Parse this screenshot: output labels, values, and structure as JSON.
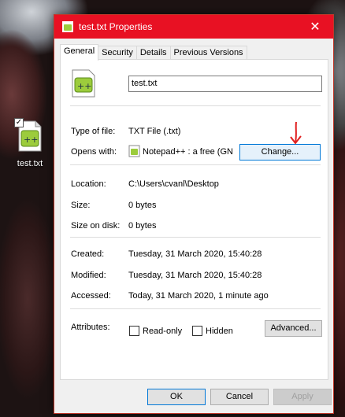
{
  "desktop": {
    "icon_label": "test.txt"
  },
  "window": {
    "title": "test.txt Properties",
    "close_glyph": "✕"
  },
  "tabs": [
    "General",
    "Security",
    "Details",
    "Previous Versions"
  ],
  "file": {
    "name": "test.txt",
    "type_label": "Type of file:",
    "type_value": "TXT File (.txt)",
    "opens_label": "Opens with:",
    "opens_value": "Notepad++ : a free (GN",
    "change_button": "Change...",
    "location_label": "Location:",
    "location_value": "C:\\Users\\cvanl\\Desktop",
    "size_label": "Size:",
    "size_value": "0 bytes",
    "size_on_disk_label": "Size on disk:",
    "size_on_disk_value": "0 bytes",
    "created_label": "Created:",
    "created_value": "Tuesday, 31 March 2020, 15:40:28",
    "modified_label": "Modified:",
    "modified_value": "Tuesday, 31 March 2020, 15:40:28",
    "accessed_label": "Accessed:",
    "accessed_value": "Today, 31 March 2020, 1 minute ago",
    "attributes_label": "Attributes:",
    "readonly_label": "Read-only",
    "hidden_label": "Hidden",
    "advanced_button": "Advanced..."
  },
  "footer": {
    "ok": "OK",
    "cancel": "Cancel",
    "apply": "Apply"
  },
  "icons": {
    "file_icon": "notepad-plus-plus-icon",
    "annotation": "red-hand-drawn-arrow"
  },
  "colors": {
    "titlebar": "#e81123",
    "focus_border": "#0078d7",
    "annotation": "#e02020"
  }
}
